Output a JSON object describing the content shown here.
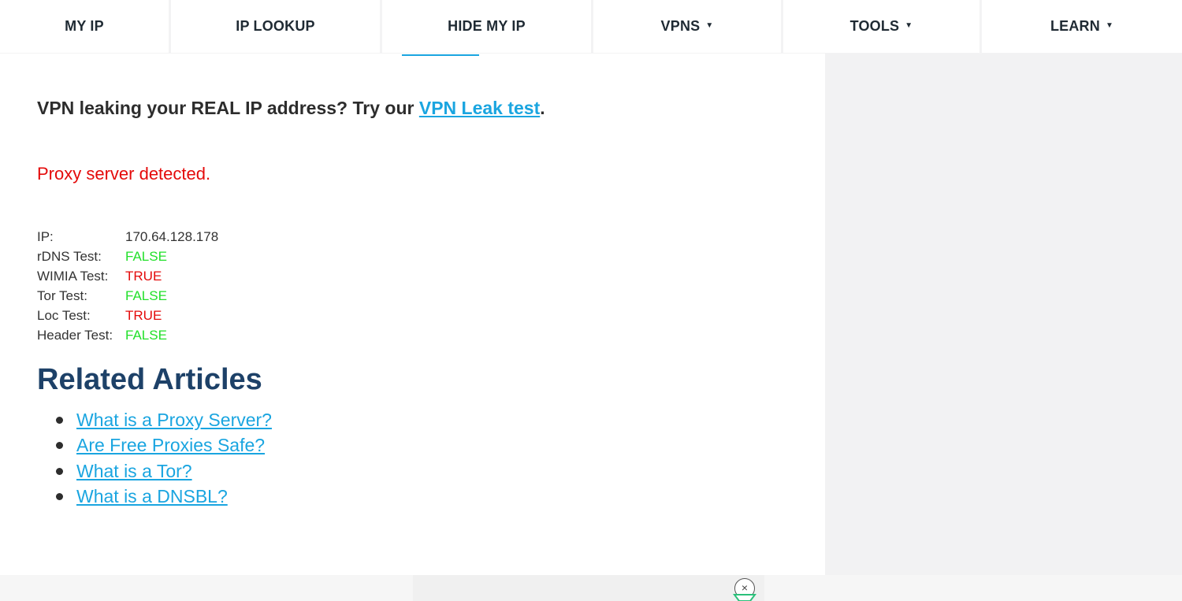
{
  "nav": {
    "items": [
      {
        "label": "MY IP",
        "caret": ""
      },
      {
        "label": "IP LOOKUP",
        "caret": ""
      },
      {
        "label": "HIDE MY IP",
        "caret": ""
      },
      {
        "label": "VPNS",
        "caret": "▼"
      },
      {
        "label": "TOOLS",
        "caret": "▼"
      },
      {
        "label": "LEARN",
        "caret": "▼"
      }
    ]
  },
  "main": {
    "leak_prefix": "VPN leaking your REAL IP address? Try our ",
    "leak_link": "VPN Leak test",
    "leak_suffix": ".",
    "proxy_status": "Proxy server detected.",
    "results": [
      {
        "label": "IP:",
        "value": "170.64.128.178"
      },
      {
        "label": "rDNS Test:",
        "value": "FALSE"
      },
      {
        "label": "WIMIA Test:",
        "value": "TRUE"
      },
      {
        "label": "Tor Test:",
        "value": "FALSE"
      },
      {
        "label": "Loc Test:",
        "value": "TRUE"
      },
      {
        "label": "Header Test:",
        "value": "FALSE"
      }
    ],
    "related_title": "Related Articles",
    "related": [
      "What is a Proxy Server?",
      "Are Free Proxies Safe?",
      "What is a Tor?",
      "What is a DNSBL?"
    ]
  },
  "ad": {
    "close_icon": "×"
  },
  "colors": {
    "link": "#1aa5e0",
    "false": "#22e02a",
    "true": "#e40a0a",
    "heading": "#1d4168"
  }
}
